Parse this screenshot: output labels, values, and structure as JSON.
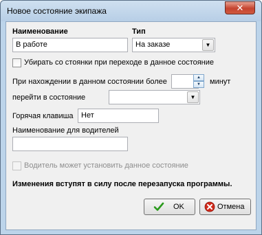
{
  "window": {
    "title": "Новое состояние экипажа",
    "close_glyph": "✕"
  },
  "form": {
    "name_label": "Наименование",
    "name_value": "В работе",
    "type_label": "Тип",
    "type_value": "На заказе",
    "remove_from_parking_label": "Убирать со стоянки при переходе в данное состояние",
    "remove_from_parking_checked": false,
    "duration_label": "При нахождении в данном состоянии более",
    "duration_value": "",
    "minutes_label": "минут",
    "goto_state_label": "перейти в состояние",
    "goto_state_value": "",
    "hotkey_label": "Горячая клавиша",
    "hotkey_value": "Нет",
    "driver_name_label": "Наименование для водителей",
    "driver_name_value": "",
    "driver_can_set_label": "Водитель может установить данное состояние",
    "driver_can_set_checked": false,
    "driver_can_set_enabled": false,
    "notice": "Изменения вступят в силу после перезапуска программы."
  },
  "buttons": {
    "ok_label": "OK",
    "cancel_label": "Отмена"
  },
  "icons": {
    "ok": "checkmark-icon",
    "cancel": "cancel-circle-icon",
    "ok_color": "#2a9a1c",
    "cancel_color": "#d22a1b"
  }
}
